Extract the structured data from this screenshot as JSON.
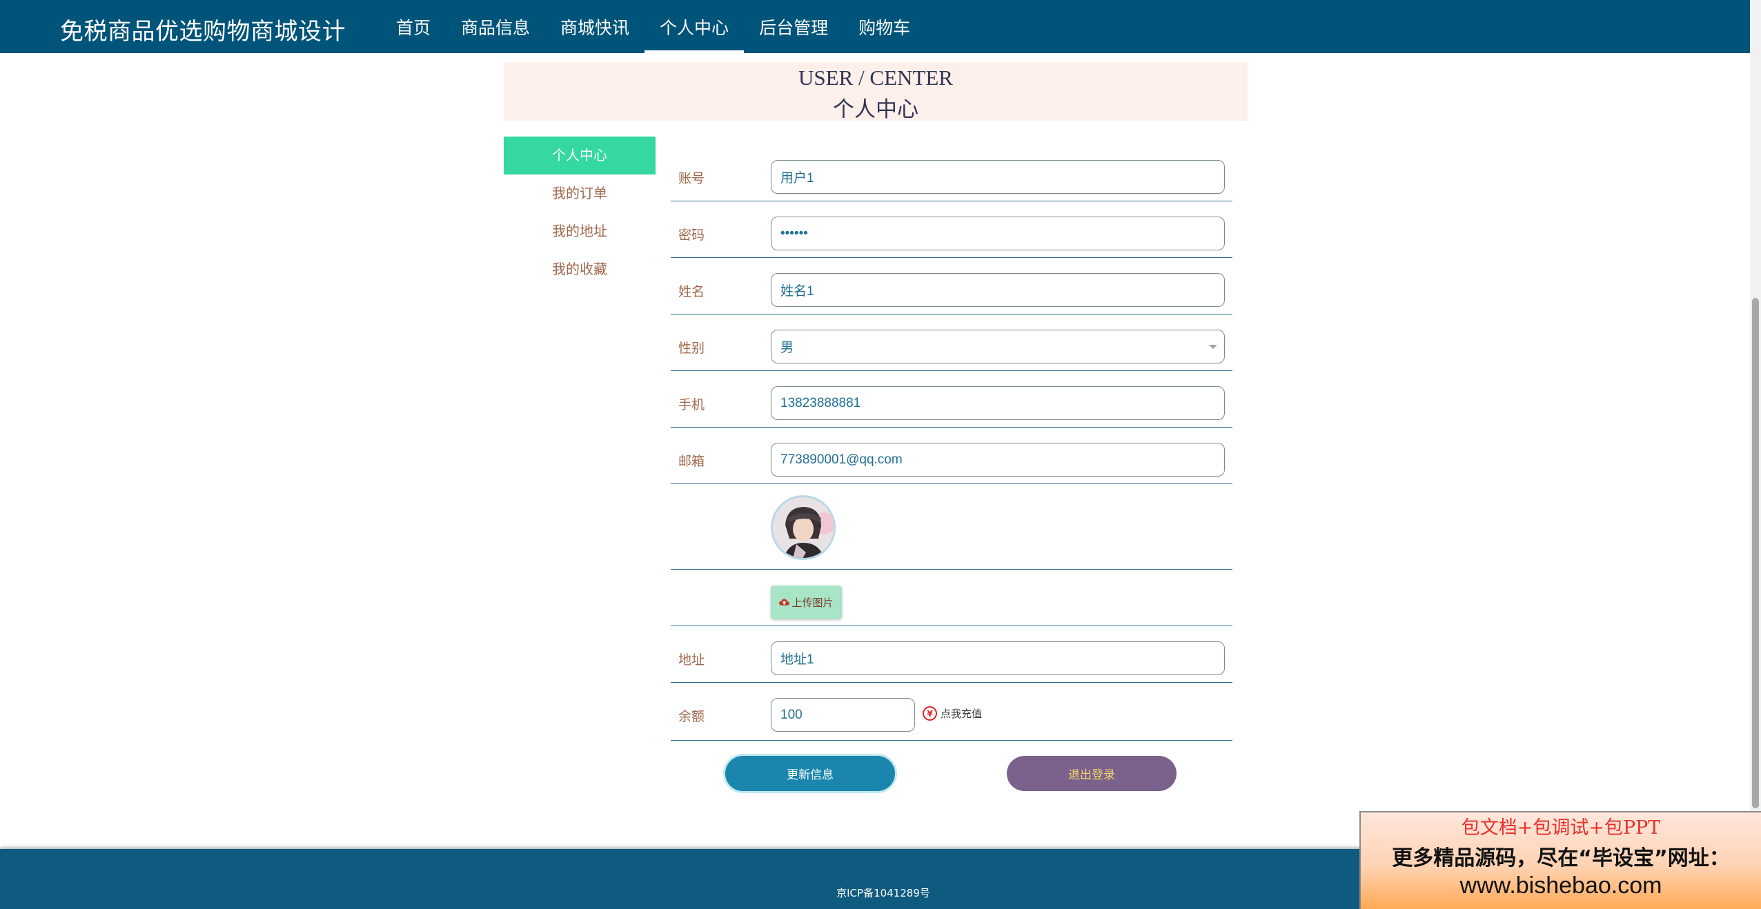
{
  "header": {
    "brand": "免税商品优选购物商城设计",
    "nav": [
      "首页",
      "商品信息",
      "商城快讯",
      "个人中心",
      "后台管理",
      "购物车"
    ],
    "active_nav": "个人中心"
  },
  "banner": {
    "en": "USER / CENTER",
    "cn": "个人中心"
  },
  "side_menu": [
    "个人中心",
    "我的订单",
    "我的地址",
    "我的收藏"
  ],
  "form": {
    "account": {
      "label": "账号",
      "value": "用户1"
    },
    "password": {
      "label": "密码",
      "value": "••••••"
    },
    "name": {
      "label": "姓名",
      "value": "姓名1"
    },
    "gender": {
      "label": "性别",
      "value": "男"
    },
    "phone": {
      "label": "手机",
      "value": "13823888881"
    },
    "email": {
      "label": "邮箱",
      "value": "773890001@qq.com"
    },
    "upload_label": "上传图片",
    "address": {
      "label": "地址",
      "value": "地址1"
    },
    "balance": {
      "label": "余额",
      "value": "100"
    },
    "recharge_symbol": "¥",
    "recharge_label": "点我充值"
  },
  "buttons": {
    "update": "更新信息",
    "logout": "退出登录"
  },
  "footer": {
    "icp": "京ICP备1041289号"
  },
  "ad": {
    "line1": "包文档+包调试+包PPT",
    "line2": "更多精品源码，尽在“毕设宝”网址：",
    "line3": "www.bishebao.com"
  }
}
